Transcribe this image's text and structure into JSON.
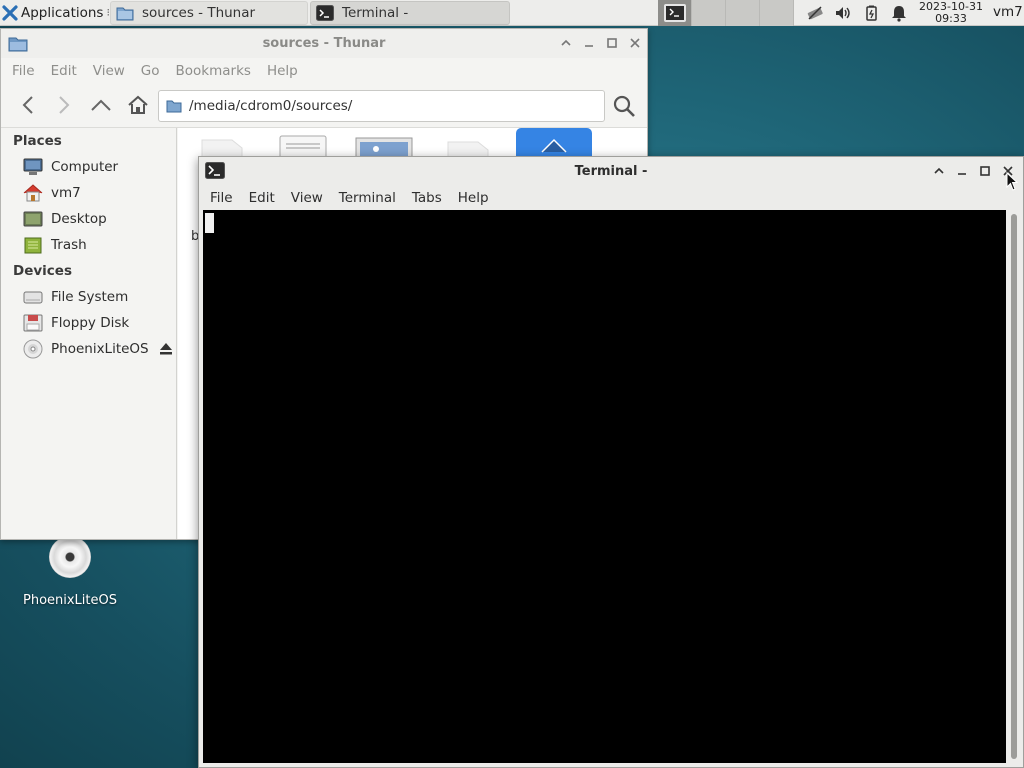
{
  "panel": {
    "applications_label": "Applications",
    "applications_sep": "⁝",
    "tasks": [
      {
        "label": "sources - Thunar",
        "icon": "folder-icon"
      },
      {
        "label": "Terminal -",
        "icon": "terminal-icon"
      }
    ],
    "clock_date": "2023-10-31",
    "clock_time": "09:33",
    "user": "vm7"
  },
  "desktop": {
    "icons": [
      {
        "label": "PhoenixLiteOS",
        "icon": "optical-disc-icon"
      }
    ]
  },
  "thunar": {
    "title": "sources - Thunar",
    "menu": [
      "File",
      "Edit",
      "View",
      "Go",
      "Bookmarks",
      "Help"
    ],
    "location": "/media/cdrom0/sources/",
    "places_heading": "Places",
    "places": [
      {
        "label": "Computer",
        "icon": "computer-icon"
      },
      {
        "label": "vm7",
        "icon": "home-icon"
      },
      {
        "label": "Desktop",
        "icon": "desktop-icon"
      },
      {
        "label": "Trash",
        "icon": "trash-icon"
      }
    ],
    "devices_heading": "Devices",
    "devices": [
      {
        "label": "File System",
        "icon": "harddisk-icon"
      },
      {
        "label": "Floppy Disk",
        "icon": "floppy-icon"
      },
      {
        "label": "PhoenixLiteOS",
        "icon": "optical-disc-icon"
      }
    ],
    "partial_filename": "b",
    "pane_handle": "«"
  },
  "terminal": {
    "title": "Terminal -",
    "menu": [
      "File",
      "Edit",
      "View",
      "Terminal",
      "Tabs",
      "Help"
    ]
  },
  "colors": {
    "desktop_bg": "#1f6678",
    "panel_bg": "#ededeb",
    "terminal_bg": "#000000",
    "selection_blue": "#3584e4"
  }
}
